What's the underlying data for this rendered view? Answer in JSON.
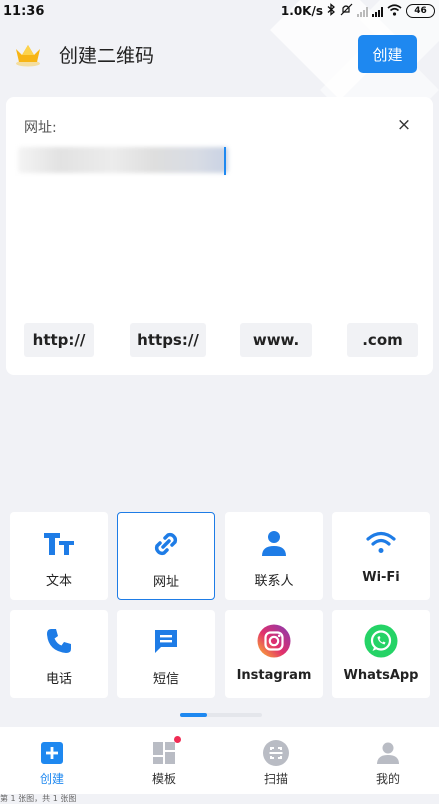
{
  "status_bar": {
    "time": "11:36",
    "speed": "1.0K/s",
    "battery": "46"
  },
  "header": {
    "title": "创建二维码",
    "create_label": "创建"
  },
  "input_card": {
    "label": "网址:",
    "value": "",
    "clear_symbol": "×",
    "quick_inserts": [
      "http://",
      "https://",
      "www.",
      ".com"
    ]
  },
  "types": [
    {
      "label": "文本",
      "icon": "text-icon",
      "selected": false
    },
    {
      "label": "网址",
      "icon": "link-icon",
      "selected": true
    },
    {
      "label": "联系人",
      "icon": "contact-icon",
      "selected": false
    },
    {
      "label": "Wi-Fi",
      "icon": "wifi-icon",
      "selected": false
    },
    {
      "label": "电话",
      "icon": "phone-icon",
      "selected": false
    },
    {
      "label": "短信",
      "icon": "sms-icon",
      "selected": false
    },
    {
      "label": "Instagram",
      "icon": "instagram-icon",
      "selected": false
    },
    {
      "label": "WhatsApp",
      "icon": "whatsapp-icon",
      "selected": false
    }
  ],
  "pager": {
    "page": 1,
    "pages": 3
  },
  "bottom_nav": [
    {
      "label": "创建",
      "icon": "create-icon",
      "active": true
    },
    {
      "label": "模板",
      "icon": "template-icon",
      "active": false,
      "badge": true
    },
    {
      "label": "扫描",
      "icon": "scan-icon",
      "active": false
    },
    {
      "label": "我的",
      "icon": "profile-icon",
      "active": false
    }
  ],
  "footer": "第 1 张图，共 1 张图",
  "colors": {
    "accent": "#1e88f0",
    "background": "#f1f2f6",
    "badge": "#ef2c54",
    "whatsapp": "#25d366"
  }
}
